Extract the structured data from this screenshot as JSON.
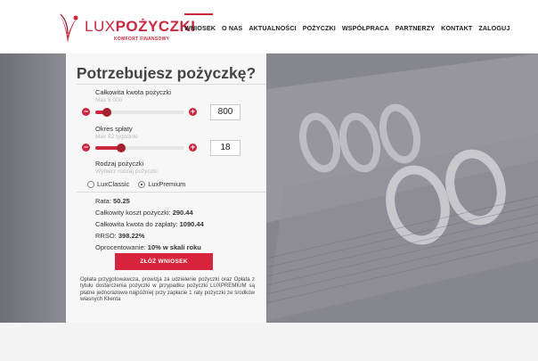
{
  "brand": {
    "logo_lux": "LUX",
    "logo_pozyczki": "POŻYCZKI",
    "logo_sub": "KOMFORT FINANSOWY",
    "accent": "#c9283e"
  },
  "nav": {
    "items": [
      {
        "label": "WNIOSEK",
        "active": true
      },
      {
        "label": "O NAS",
        "active": false
      },
      {
        "label": "AKTUALNOŚCI",
        "active": false
      },
      {
        "label": "POŻYCZKI",
        "active": false
      },
      {
        "label": "WSPÓŁPRACA",
        "active": false
      },
      {
        "label": "PARTNERZY",
        "active": false
      },
      {
        "label": "KONTAKT",
        "active": false
      },
      {
        "label": "ZALOGUJ",
        "active": false
      }
    ]
  },
  "form": {
    "title": "Potrzebujesz pożyczkę?",
    "amount": {
      "label": "Całkowita kwota pożyczki",
      "hint": "Max 6 000",
      "value": "800",
      "fill_fraction": 0.13
    },
    "term": {
      "label": "Okres spłaty",
      "hint": "Max 62 tygodnie",
      "value": "18",
      "fill_fraction": 0.29
    },
    "type": {
      "label": "Rodzaj pożyczki",
      "hint": "Wybierz rodzaj pożyczki",
      "options": [
        "LuxClassic",
        "LuxPremium"
      ],
      "selected": "LuxPremium"
    },
    "summary": {
      "rata_label": "Rata:",
      "rata_value": "50.25",
      "cost_label": "Całkowity koszt pożyczki:",
      "cost_value": "290.44",
      "total_label": "Całkowita kwota do zapłaty:",
      "total_value": "1090.44",
      "rrso_label": "RRSO:",
      "rrso_value": "398.22%",
      "interest_label": "Oprocentowanie:",
      "interest_value": "10% w skali roku"
    },
    "submit_label": "ZŁÓŻ WNIOSEK",
    "disclaimer": "Opłata przygotowawcza, prowizja za udzielenie pożyczki oraz Opłata z tytułu dostarczenia pożyczki w przypadku pożyczki LUXPREMIUM są płatne jednorazowo najpóźniej przy zapłacie 1 raty pożyczki ze środków własnych Klienta"
  }
}
